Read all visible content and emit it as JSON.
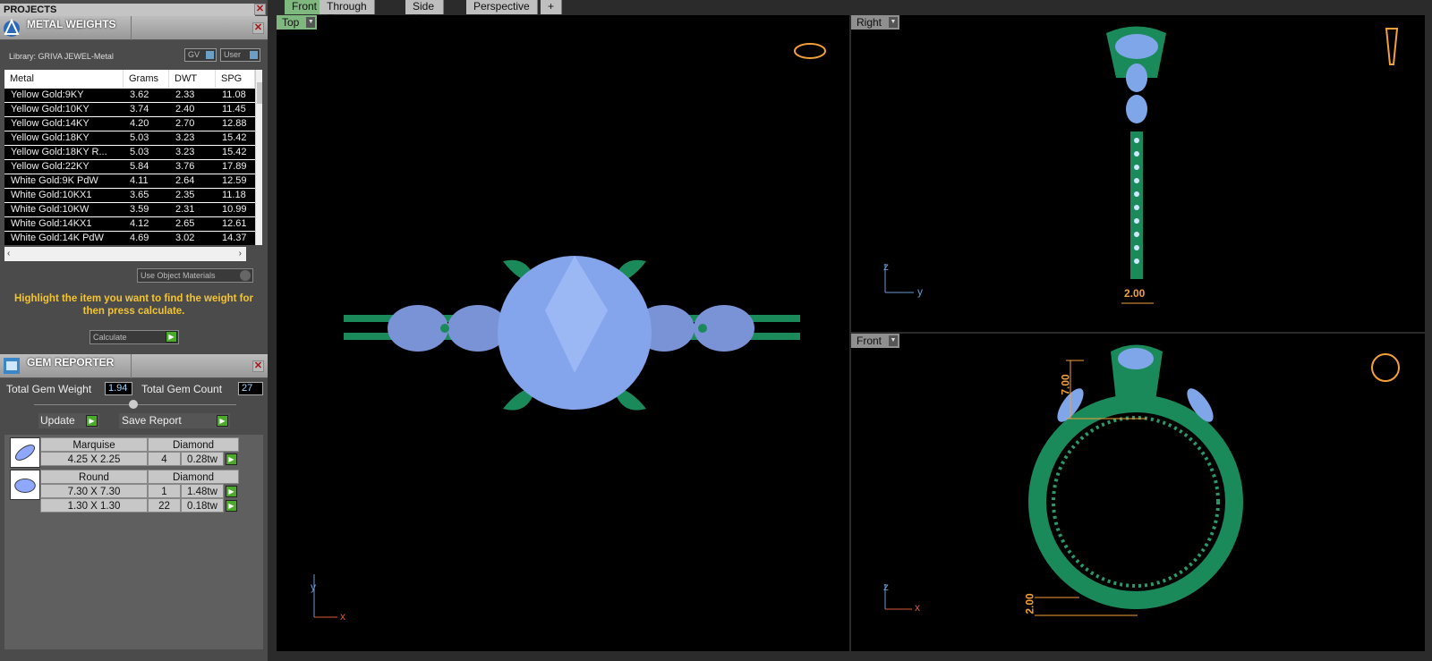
{
  "projects": {
    "title": "PROJECTS"
  },
  "metal_weights": {
    "title": "METAL WEIGHTS",
    "library": "Library: GRIVA JEWEL-Metal",
    "gv_label": "GV",
    "user_label": "User",
    "columns": [
      "Metal",
      "Grams",
      "DWT",
      "SPG"
    ],
    "rows": [
      [
        "Yellow Gold:9KY",
        "3.62",
        "2.33",
        "11.08"
      ],
      [
        "Yellow Gold:10KY",
        "3.74",
        "2.40",
        "11.45"
      ],
      [
        "Yellow Gold:14KY",
        "4.20",
        "2.70",
        "12.88"
      ],
      [
        "Yellow Gold:18KY",
        "5.03",
        "3.23",
        "15.42"
      ],
      [
        "Yellow Gold:18KY R...",
        "5.03",
        "3.23",
        "15.42"
      ],
      [
        "Yellow Gold:22KY",
        "5.84",
        "3.76",
        "17.89"
      ],
      [
        "White Gold:9K PdW",
        "4.11",
        "2.64",
        "12.59"
      ],
      [
        "White Gold:10KX1",
        "3.65",
        "2.35",
        "11.18"
      ],
      [
        "White Gold:10KW",
        "3.59",
        "2.31",
        "10.99"
      ],
      [
        "White Gold:14KX1",
        "4.12",
        "2.65",
        "12.61"
      ],
      [
        "White Gold:14K PdW",
        "4.69",
        "3.02",
        "14.37"
      ]
    ],
    "use_object_materials": "Use Object Materials",
    "hint": "Highlight the item you want to find the weight for then press calculate.",
    "calculate_label": "Calculate"
  },
  "gem_reporter": {
    "title": "GEM REPORTER",
    "total_weight_label": "Total Gem Weight",
    "total_weight": "1.94",
    "total_count_label": "Total Gem Count",
    "total_count": "27",
    "update_label": "Update",
    "save_label": "Save Report",
    "groups": [
      {
        "shape": "Marquise",
        "material": "Diamond",
        "rows": [
          [
            "4.25 X 2.25",
            "4",
            "0.28tw"
          ]
        ]
      },
      {
        "shape": "Round",
        "material": "Diamond",
        "rows": [
          [
            "7.30 X 7.30",
            "1",
            "1.48tw"
          ],
          [
            "1.30 X 1.30",
            "22",
            "0.18tw"
          ]
        ]
      }
    ]
  },
  "tabs": [
    "Front",
    "Through Finger",
    "Side View",
    "Perspective",
    "+"
  ],
  "viewports": {
    "top": {
      "label": "Top",
      "axis_v": "y",
      "axis_h": "x"
    },
    "right": {
      "label": "Right",
      "axis_v": "z",
      "axis_h": "y",
      "dim": "2.00"
    },
    "front": {
      "label": "Front",
      "axis_v": "z",
      "axis_h": "x",
      "dim_top": "7.00",
      "dim_bottom": "2.00"
    }
  },
  "colors": {
    "metal": "#1a8a5a",
    "gem": "#7fa6e8",
    "accent": "#f4a03a"
  }
}
